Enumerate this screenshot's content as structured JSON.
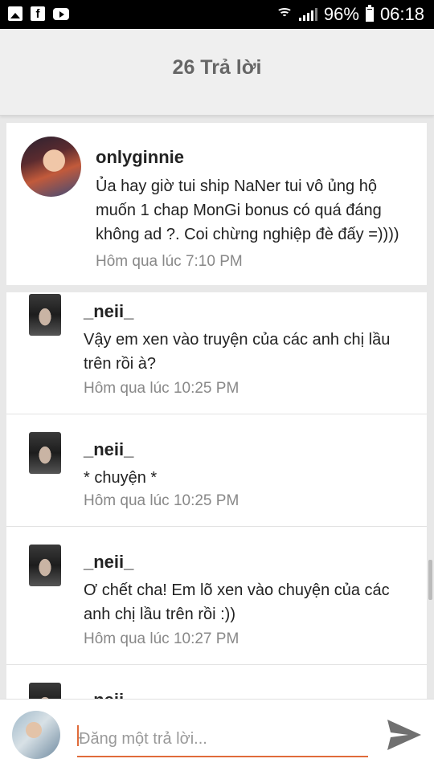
{
  "status_bar": {
    "left_icons": [
      "gallery-icon",
      "facebook-icon",
      "youtube-icon"
    ],
    "battery": "96%",
    "time": "06:18"
  },
  "header": {
    "title": "26 Trả lời"
  },
  "main_comment": {
    "username": "onlyginnie",
    "text": "Ủa hay giờ tui ship NaNer tui vô ủng hộ muốn 1 chap MonGi bonus có quá đáng không ad ?. Coi chừng nghiệp đè đấy =))))",
    "time": "Hôm qua lúc 7:10 PM"
  },
  "replies": [
    {
      "username": "_neii_",
      "text": "Vậy em xen vào truyện của các anh chị lầu trên rồi à?",
      "time": "Hôm qua lúc 10:25 PM"
    },
    {
      "username": "_neii_",
      "text": "* chuyện *",
      "time": "Hôm qua lúc 10:25 PM"
    },
    {
      "username": "_neii_",
      "text": "Ơ chết cha! Em lõ xen vào chuyện của các anh chị lầu trên rồi :))",
      "time": "Hôm qua lúc 10:27 PM"
    },
    {
      "username": "_neii_"
    }
  ],
  "input": {
    "placeholder": "Đăng một trả lời..."
  },
  "colors": {
    "accent": "#e06b3a",
    "header_bg": "#efefef",
    "time_text": "#888888"
  }
}
